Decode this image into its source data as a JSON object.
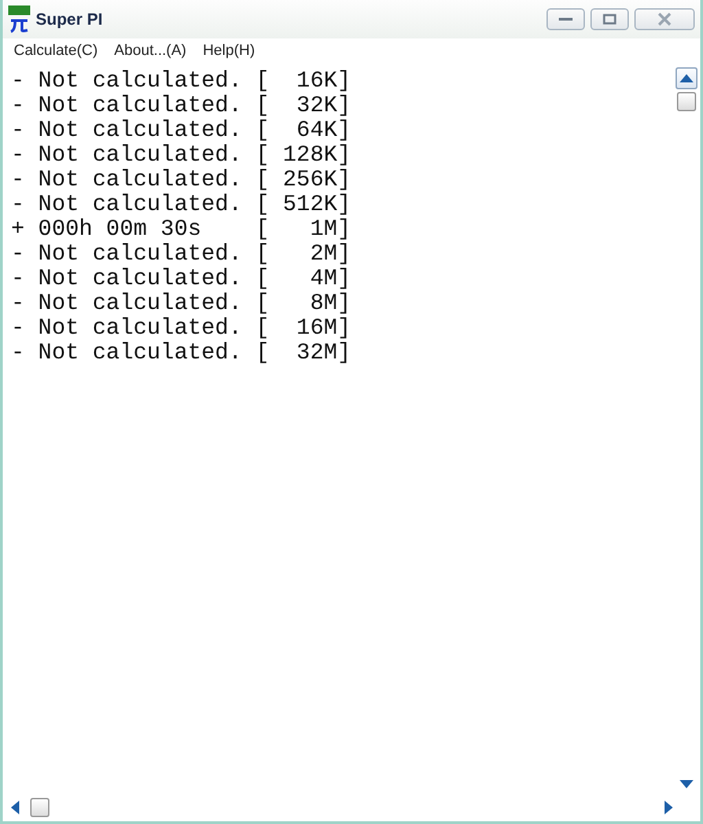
{
  "window": {
    "title": "Super PI"
  },
  "menu": [
    "Calculate(C)",
    "About...(A)",
    "Help(H)"
  ],
  "lines": [
    "- Not calculated. [  16K]",
    "- Not calculated. [  32K]",
    "- Not calculated. [  64K]",
    "- Not calculated. [ 128K]",
    "- Not calculated. [ 256K]",
    "- Not calculated. [ 512K]",
    "+ 000h 00m 30s    [   1M]",
    "- Not calculated. [   2M]",
    "- Not calculated. [   4M]",
    "- Not calculated. [   8M]",
    "- Not calculated. [  16M]",
    "- Not calculated. [  32M]"
  ]
}
